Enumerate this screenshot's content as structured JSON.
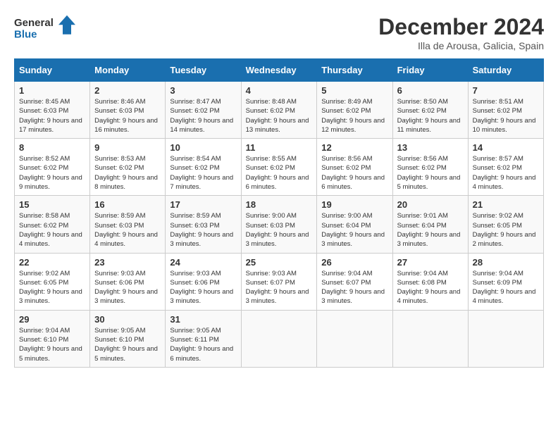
{
  "logo": {
    "line1": "General",
    "line2": "Blue"
  },
  "title": "December 2024",
  "subtitle": "Illa de Arousa, Galicia, Spain",
  "weekdays": [
    "Sunday",
    "Monday",
    "Tuesday",
    "Wednesday",
    "Thursday",
    "Friday",
    "Saturday"
  ],
  "weeks": [
    [
      {
        "day": "1",
        "sunrise": "Sunrise: 8:45 AM",
        "sunset": "Sunset: 6:03 PM",
        "daylight": "Daylight: 9 hours and 17 minutes."
      },
      {
        "day": "2",
        "sunrise": "Sunrise: 8:46 AM",
        "sunset": "Sunset: 6:03 PM",
        "daylight": "Daylight: 9 hours and 16 minutes."
      },
      {
        "day": "3",
        "sunrise": "Sunrise: 8:47 AM",
        "sunset": "Sunset: 6:02 PM",
        "daylight": "Daylight: 9 hours and 14 minutes."
      },
      {
        "day": "4",
        "sunrise": "Sunrise: 8:48 AM",
        "sunset": "Sunset: 6:02 PM",
        "daylight": "Daylight: 9 hours and 13 minutes."
      },
      {
        "day": "5",
        "sunrise": "Sunrise: 8:49 AM",
        "sunset": "Sunset: 6:02 PM",
        "daylight": "Daylight: 9 hours and 12 minutes."
      },
      {
        "day": "6",
        "sunrise": "Sunrise: 8:50 AM",
        "sunset": "Sunset: 6:02 PM",
        "daylight": "Daylight: 9 hours and 11 minutes."
      },
      {
        "day": "7",
        "sunrise": "Sunrise: 8:51 AM",
        "sunset": "Sunset: 6:02 PM",
        "daylight": "Daylight: 9 hours and 10 minutes."
      }
    ],
    [
      {
        "day": "8",
        "sunrise": "Sunrise: 8:52 AM",
        "sunset": "Sunset: 6:02 PM",
        "daylight": "Daylight: 9 hours and 9 minutes."
      },
      {
        "day": "9",
        "sunrise": "Sunrise: 8:53 AM",
        "sunset": "Sunset: 6:02 PM",
        "daylight": "Daylight: 9 hours and 8 minutes."
      },
      {
        "day": "10",
        "sunrise": "Sunrise: 8:54 AM",
        "sunset": "Sunset: 6:02 PM",
        "daylight": "Daylight: 9 hours and 7 minutes."
      },
      {
        "day": "11",
        "sunrise": "Sunrise: 8:55 AM",
        "sunset": "Sunset: 6:02 PM",
        "daylight": "Daylight: 9 hours and 6 minutes."
      },
      {
        "day": "12",
        "sunrise": "Sunrise: 8:56 AM",
        "sunset": "Sunset: 6:02 PM",
        "daylight": "Daylight: 9 hours and 6 minutes."
      },
      {
        "day": "13",
        "sunrise": "Sunrise: 8:56 AM",
        "sunset": "Sunset: 6:02 PM",
        "daylight": "Daylight: 9 hours and 5 minutes."
      },
      {
        "day": "14",
        "sunrise": "Sunrise: 8:57 AM",
        "sunset": "Sunset: 6:02 PM",
        "daylight": "Daylight: 9 hours and 4 minutes."
      }
    ],
    [
      {
        "day": "15",
        "sunrise": "Sunrise: 8:58 AM",
        "sunset": "Sunset: 6:02 PM",
        "daylight": "Daylight: 9 hours and 4 minutes."
      },
      {
        "day": "16",
        "sunrise": "Sunrise: 8:59 AM",
        "sunset": "Sunset: 6:03 PM",
        "daylight": "Daylight: 9 hours and 4 minutes."
      },
      {
        "day": "17",
        "sunrise": "Sunrise: 8:59 AM",
        "sunset": "Sunset: 6:03 PM",
        "daylight": "Daylight: 9 hours and 3 minutes."
      },
      {
        "day": "18",
        "sunrise": "Sunrise: 9:00 AM",
        "sunset": "Sunset: 6:03 PM",
        "daylight": "Daylight: 9 hours and 3 minutes."
      },
      {
        "day": "19",
        "sunrise": "Sunrise: 9:00 AM",
        "sunset": "Sunset: 6:04 PM",
        "daylight": "Daylight: 9 hours and 3 minutes."
      },
      {
        "day": "20",
        "sunrise": "Sunrise: 9:01 AM",
        "sunset": "Sunset: 6:04 PM",
        "daylight": "Daylight: 9 hours and 3 minutes."
      },
      {
        "day": "21",
        "sunrise": "Sunrise: 9:02 AM",
        "sunset": "Sunset: 6:05 PM",
        "daylight": "Daylight: 9 hours and 2 minutes."
      }
    ],
    [
      {
        "day": "22",
        "sunrise": "Sunrise: 9:02 AM",
        "sunset": "Sunset: 6:05 PM",
        "daylight": "Daylight: 9 hours and 3 minutes."
      },
      {
        "day": "23",
        "sunrise": "Sunrise: 9:03 AM",
        "sunset": "Sunset: 6:06 PM",
        "daylight": "Daylight: 9 hours and 3 minutes."
      },
      {
        "day": "24",
        "sunrise": "Sunrise: 9:03 AM",
        "sunset": "Sunset: 6:06 PM",
        "daylight": "Daylight: 9 hours and 3 minutes."
      },
      {
        "day": "25",
        "sunrise": "Sunrise: 9:03 AM",
        "sunset": "Sunset: 6:07 PM",
        "daylight": "Daylight: 9 hours and 3 minutes."
      },
      {
        "day": "26",
        "sunrise": "Sunrise: 9:04 AM",
        "sunset": "Sunset: 6:07 PM",
        "daylight": "Daylight: 9 hours and 3 minutes."
      },
      {
        "day": "27",
        "sunrise": "Sunrise: 9:04 AM",
        "sunset": "Sunset: 6:08 PM",
        "daylight": "Daylight: 9 hours and 4 minutes."
      },
      {
        "day": "28",
        "sunrise": "Sunrise: 9:04 AM",
        "sunset": "Sunset: 6:09 PM",
        "daylight": "Daylight: 9 hours and 4 minutes."
      }
    ],
    [
      {
        "day": "29",
        "sunrise": "Sunrise: 9:04 AM",
        "sunset": "Sunset: 6:10 PM",
        "daylight": "Daylight: 9 hours and 5 minutes."
      },
      {
        "day": "30",
        "sunrise": "Sunrise: 9:05 AM",
        "sunset": "Sunset: 6:10 PM",
        "daylight": "Daylight: 9 hours and 5 minutes."
      },
      {
        "day": "31",
        "sunrise": "Sunrise: 9:05 AM",
        "sunset": "Sunset: 6:11 PM",
        "daylight": "Daylight: 9 hours and 6 minutes."
      },
      null,
      null,
      null,
      null
    ]
  ]
}
